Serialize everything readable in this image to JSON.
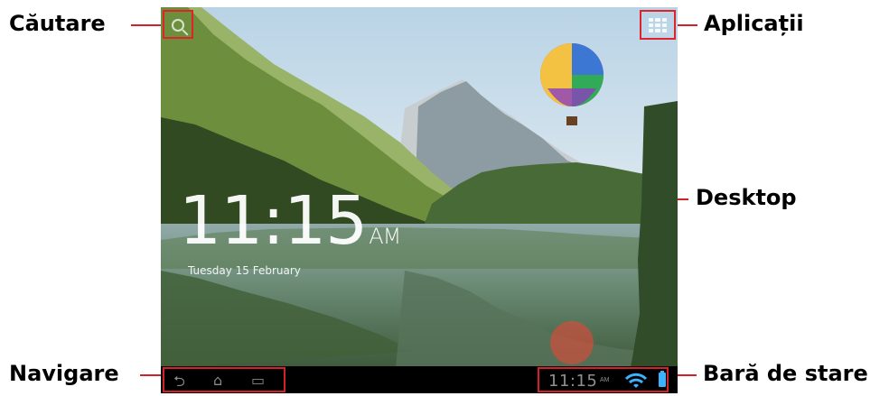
{
  "labels": {
    "search": "Căutare",
    "apps": "Aplicații",
    "desktop": "Desktop",
    "navigation": "Navigare",
    "status_bar": "Bară de stare"
  },
  "home": {
    "time": "11:15",
    "ampm": "AM",
    "date": "Tuesday 15 February"
  },
  "status": {
    "time": "11:15",
    "ampm": "AM"
  },
  "icons": {
    "search": "search-icon",
    "apps": "apps-grid-icon",
    "back": "back-icon",
    "home": "home-icon",
    "recent": "recent-apps-icon",
    "wifi": "wifi-icon",
    "battery": "battery-icon"
  },
  "colors": {
    "annotation": "#d61f26",
    "clock_text": "#ffffff",
    "status_text": "#8f8f8f",
    "battery": "#3bb1ff"
  }
}
